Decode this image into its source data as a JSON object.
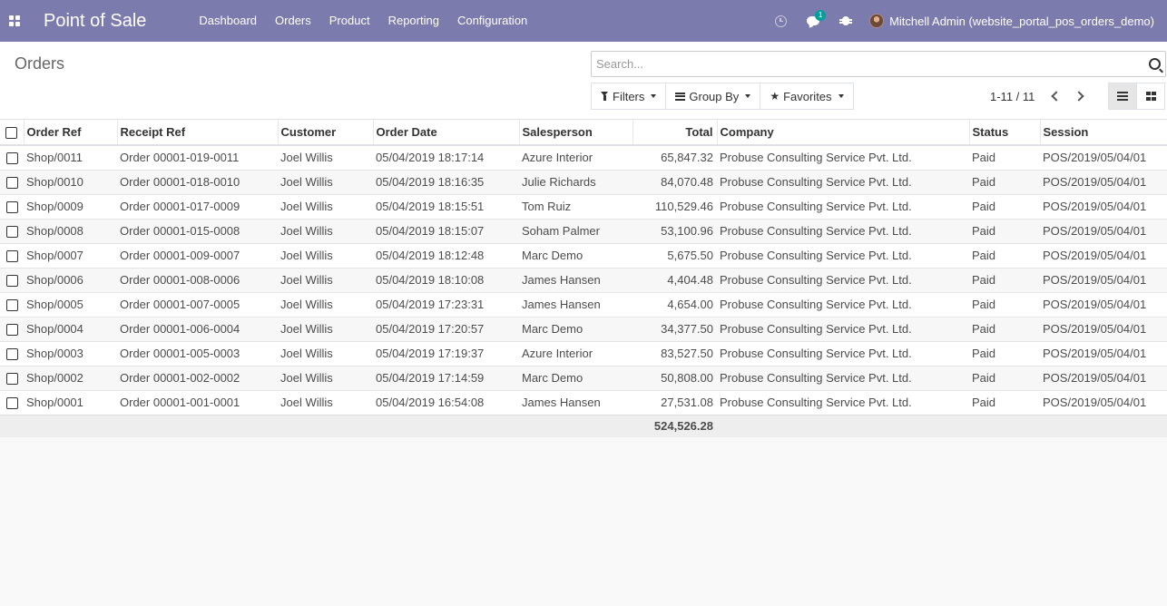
{
  "navbar": {
    "app_title": "Point of Sale",
    "menu": [
      "Dashboard",
      "Orders",
      "Product",
      "Reporting",
      "Configuration"
    ],
    "chat_badge": "1",
    "user_name": "Mitchell Admin (website_portal_pos_orders_demo)"
  },
  "control_panel": {
    "breadcrumb": "Orders",
    "search_placeholder": "Search...",
    "filters_label": "Filters",
    "groupby_label": "Group By",
    "favorites_label": "Favorites",
    "pager": "1-11 / 11"
  },
  "table": {
    "columns": [
      "Order Ref",
      "Receipt Ref",
      "Customer",
      "Order Date",
      "Salesperson",
      "Total",
      "Company",
      "Status",
      "Session"
    ],
    "rows": [
      [
        "Shop/0011",
        "Order 00001-019-0011",
        "Joel Willis",
        "05/04/2019 18:17:14",
        "Azure Interior",
        "65,847.32",
        "Probuse Consulting Service Pvt. Ltd.",
        "Paid",
        "POS/2019/05/04/01"
      ],
      [
        "Shop/0010",
        "Order 00001-018-0010",
        "Joel Willis",
        "05/04/2019 18:16:35",
        "Julie Richards",
        "84,070.48",
        "Probuse Consulting Service Pvt. Ltd.",
        "Paid",
        "POS/2019/05/04/01"
      ],
      [
        "Shop/0009",
        "Order 00001-017-0009",
        "Joel Willis",
        "05/04/2019 18:15:51",
        "Tom Ruiz",
        "110,529.46",
        "Probuse Consulting Service Pvt. Ltd.",
        "Paid",
        "POS/2019/05/04/01"
      ],
      [
        "Shop/0008",
        "Order 00001-015-0008",
        "Joel Willis",
        "05/04/2019 18:15:07",
        "Soham Palmer",
        "53,100.96",
        "Probuse Consulting Service Pvt. Ltd.",
        "Paid",
        "POS/2019/05/04/01"
      ],
      [
        "Shop/0007",
        "Order 00001-009-0007",
        "Joel Willis",
        "05/04/2019 18:12:48",
        "Marc Demo",
        "5,675.50",
        "Probuse Consulting Service Pvt. Ltd.",
        "Paid",
        "POS/2019/05/04/01"
      ],
      [
        "Shop/0006",
        "Order 00001-008-0006",
        "Joel Willis",
        "05/04/2019 18:10:08",
        "James Hansen",
        "4,404.48",
        "Probuse Consulting Service Pvt. Ltd.",
        "Paid",
        "POS/2019/05/04/01"
      ],
      [
        "Shop/0005",
        "Order 00001-007-0005",
        "Joel Willis",
        "05/04/2019 17:23:31",
        "James Hansen",
        "4,654.00",
        "Probuse Consulting Service Pvt. Ltd.",
        "Paid",
        "POS/2019/05/04/01"
      ],
      [
        "Shop/0004",
        "Order 00001-006-0004",
        "Joel Willis",
        "05/04/2019 17:20:57",
        "Marc Demo",
        "34,377.50",
        "Probuse Consulting Service Pvt. Ltd.",
        "Paid",
        "POS/2019/05/04/01"
      ],
      [
        "Shop/0003",
        "Order 00001-005-0003",
        "Joel Willis",
        "05/04/2019 17:19:37",
        "Azure Interior",
        "83,527.50",
        "Probuse Consulting Service Pvt. Ltd.",
        "Paid",
        "POS/2019/05/04/01"
      ],
      [
        "Shop/0002",
        "Order 00001-002-0002",
        "Joel Willis",
        "05/04/2019 17:14:59",
        "Marc Demo",
        "50,808.00",
        "Probuse Consulting Service Pvt. Ltd.",
        "Paid",
        "POS/2019/05/04/01"
      ],
      [
        "Shop/0001",
        "Order 00001-001-0001",
        "Joel Willis",
        "05/04/2019 16:54:08",
        "James Hansen",
        "27,531.08",
        "Probuse Consulting Service Pvt. Ltd.",
        "Paid",
        "POS/2019/05/04/01"
      ]
    ],
    "footer_total": "524,526.28"
  },
  "colors": {
    "navbar": "#7c7bad",
    "badge": "#00a09d"
  }
}
